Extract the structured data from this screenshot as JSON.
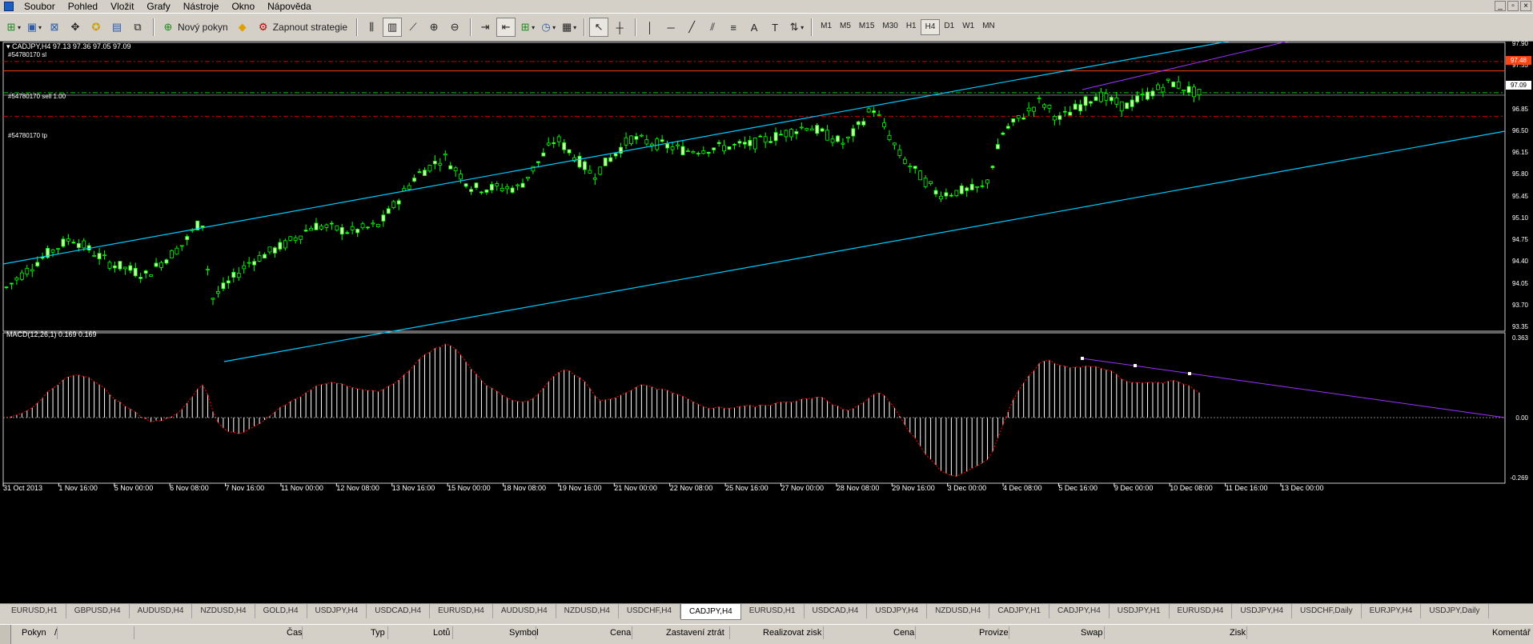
{
  "menu": {
    "items": [
      "Soubor",
      "Pohled",
      "Vložit",
      "Grafy",
      "Nástroje",
      "Okno",
      "Nápověda"
    ]
  },
  "toolbar": {
    "new_order_label": "Nový pokyn",
    "strategy_label": "Zapnout strategie",
    "timeframes": [
      "M1",
      "M5",
      "M15",
      "M30",
      "H1",
      "H4",
      "D1",
      "W1",
      "MN"
    ],
    "active_timeframe": "H4"
  },
  "chart": {
    "header": "CADJPY,H4  97.13 97.36 97.05 97.09",
    "order_sl": "#54780170 sl",
    "order_sell": "#54780170 sell 1.00",
    "order_tp": "#54780170 tp",
    "price_axis": [
      "97.90",
      "97.55",
      "97.20",
      "96.85",
      "96.50",
      "96.15",
      "95.80",
      "95.45",
      "95.10",
      "94.75",
      "94.40",
      "94.05",
      "93.70",
      "93.35"
    ],
    "sl_price": "97.48",
    "bid_price": "97.09",
    "macd_label": "MACD(12,26,1) 0.169 0.169",
    "macd_axis": [
      "0.363",
      "0.00",
      "-0.269"
    ],
    "time_axis": [
      "31 Oct 2013",
      "1 Nov 16:00",
      "5 Nov 00:00",
      "6 Nov 08:00",
      "7 Nov 16:00",
      "11 Nov 00:00",
      "12 Nov 08:00",
      "13 Nov 16:00",
      "15 Nov 00:00",
      "18 Nov 08:00",
      "19 Nov 16:00",
      "21 Nov 00:00",
      "22 Nov 08:00",
      "25 Nov 16:00",
      "27 Nov 00:00",
      "28 Nov 08:00",
      "29 Nov 16:00",
      "3 Dec 00:00",
      "4 Dec 08:00",
      "5 Dec 16:00",
      "9 Dec 00:00",
      "10 Dec 08:00",
      "11 Dec 16:00",
      "13 Dec 00:00"
    ],
    "colors": {
      "background": "#000000",
      "bull": "#ccffaa",
      "bear": "#000000",
      "wick": "#00ff00",
      "channel": "#00ccff",
      "trend": "#9933ff",
      "macd_signal": "#ff0000",
      "sl_line": "#ff4411",
      "entry_line": "#00cc00",
      "order_dash": "#cc0000"
    }
  },
  "tabs": {
    "items": [
      "EURUSD,H1",
      "GBPUSD,H4",
      "AUDUSD,H4",
      "NZDUSD,H4",
      "GOLD,H4",
      "USDJPY,H4",
      "USDCAD,H4",
      "EURUSD,H4",
      "AUDUSD,H4",
      "NZDUSD,H4",
      "USDCHF,H4",
      "CADJPY,H4",
      "EURUSD,H1",
      "USDCAD,H4",
      "USDJPY,H4",
      "NZDUSD,H4",
      "CADJPY,H1",
      "CADJPY,H4",
      "USDJPY,H1",
      "EURUSD,H4",
      "USDJPY,H4",
      "USDCHF,Daily",
      "EURJPY,H4",
      "USDJPY,Daily"
    ],
    "active_index": 11
  },
  "terminal": {
    "columns": [
      "Pokyn",
      "/",
      "Čas",
      "Typ",
      "Lotů",
      "Symbol",
      "Cena",
      "Zastavení ztrát",
      "Realizovat zisk",
      "Cena",
      "Provize",
      "Swap",
      "Zisk",
      "Komentář"
    ]
  }
}
